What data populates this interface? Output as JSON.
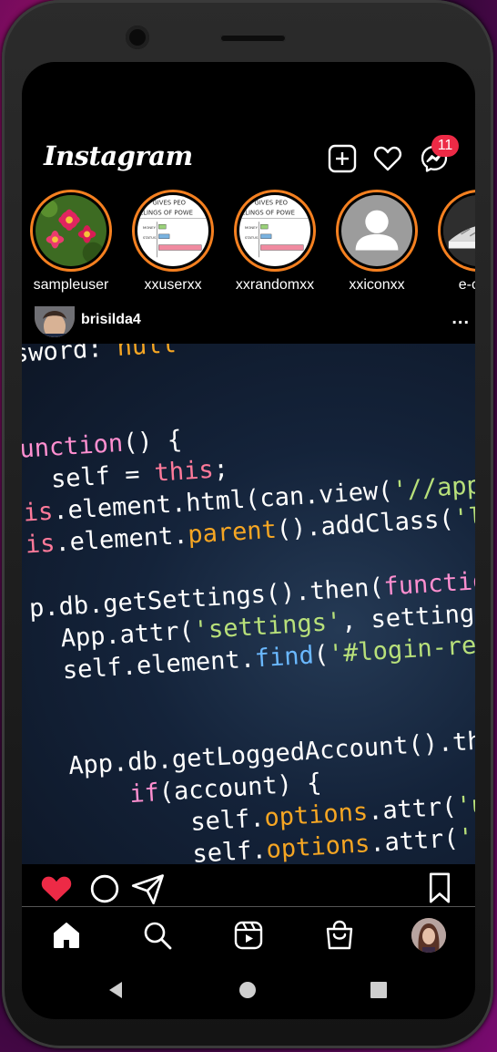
{
  "app": {
    "logo": "Instagram",
    "messages_badge": "11"
  },
  "stories": [
    {
      "username": "sampleuser",
      "image": "flower"
    },
    {
      "username": "xxuserxx",
      "image": "chart"
    },
    {
      "username": "xxrandomxx",
      "image": "chart"
    },
    {
      "username": "xxiconxx",
      "image": "default-avatar"
    },
    {
      "username": "e-com",
      "image": "shoe"
    }
  ],
  "chart_story": {
    "title_line1": "ST GIVES PEO",
    "title_line2": "ELINGS OF POWE",
    "labels": [
      "MONEY",
      "STATUS"
    ]
  },
  "post": {
    "username": "brisilda4",
    "more": "...",
    "code_lines": [
      [
        {
          "t": "sword: ",
          "c": "#ffffff"
        },
        {
          "t": "null",
          "c": "#f6a623"
        }
      ],
      [
        {
          "t": "",
          "c": "#ffffff"
        }
      ],
      [
        {
          "t": "",
          "c": "#ffffff"
        }
      ],
      [
        {
          "t": "unction",
          "c": "#ff8fd0"
        },
        {
          "t": "() {",
          "c": "#ffffff"
        }
      ],
      [
        {
          "t": "  self = ",
          "c": "#ffffff"
        },
        {
          "t": "this",
          "c": "#ff7a9a"
        },
        {
          "t": ";",
          "c": "#ffffff"
        }
      ],
      [
        {
          "t": "is",
          "c": "#ff7a9a"
        },
        {
          "t": ".element.html(can.view(",
          "c": "#ffffff"
        },
        {
          "t": "'//app/",
          "c": "#b8e07a"
        }
      ],
      [
        {
          "t": "is",
          "c": "#ff7a9a"
        },
        {
          "t": ".element.",
          "c": "#ffffff"
        },
        {
          "t": "parent",
          "c": "#f6a623"
        },
        {
          "t": "().addClass(",
          "c": "#ffffff"
        },
        {
          "t": "'lo",
          "c": "#b8e07a"
        }
      ],
      [
        {
          "t": "",
          "c": "#ffffff"
        }
      ],
      [
        {
          "t": "p.db.getSettings().then(",
          "c": "#ffffff"
        },
        {
          "t": "functio",
          "c": "#ff8fd0"
        }
      ],
      [
        {
          "t": "  App.attr(",
          "c": "#ffffff"
        },
        {
          "t": "'settings'",
          "c": "#b8e07a"
        },
        {
          "t": ", settings",
          "c": "#ffffff"
        }
      ],
      [
        {
          "t": "  self.element.",
          "c": "#ffffff"
        },
        {
          "t": "find",
          "c": "#6ab8ff"
        },
        {
          "t": "(",
          "c": "#ffffff"
        },
        {
          "t": "'#login-rem",
          "c": "#b8e07a"
        }
      ],
      [
        {
          "t": "",
          "c": "#ffffff"
        }
      ],
      [
        {
          "t": "",
          "c": "#ffffff"
        }
      ],
      [
        {
          "t": "  App.db.getLoggedAccount().the",
          "c": "#ffffff"
        }
      ],
      [
        {
          "t": "      if",
          "c": "#ff8fd0"
        },
        {
          "t": "(account) {",
          "c": "#ffffff"
        }
      ],
      [
        {
          "t": "          self.",
          "c": "#ffffff"
        },
        {
          "t": "options",
          "c": "#f6a623"
        },
        {
          "t": ".attr(",
          "c": "#ffffff"
        },
        {
          "t": "'us",
          "c": "#b8e07a"
        }
      ],
      [
        {
          "t": "          self.",
          "c": "#ffffff"
        },
        {
          "t": "options",
          "c": "#f6a623"
        },
        {
          "t": ".attr(",
          "c": "#ffffff"
        },
        {
          "t": "'pa",
          "c": "#b8e07a"
        }
      ]
    ]
  },
  "colors": {
    "accent": "#f58020",
    "badge": "#ed2a46",
    "like": "#ed2a46"
  },
  "icons": {
    "header": [
      "add-post-icon",
      "heart-icon",
      "messenger-icon"
    ],
    "actions": [
      "like-icon",
      "comment-icon",
      "share-icon",
      "bookmark-icon"
    ],
    "nav": [
      "home-icon",
      "search-icon",
      "reels-icon",
      "shop-icon",
      "profile-avatar"
    ],
    "system": [
      "back-icon",
      "home-circle-icon",
      "recents-icon"
    ]
  }
}
